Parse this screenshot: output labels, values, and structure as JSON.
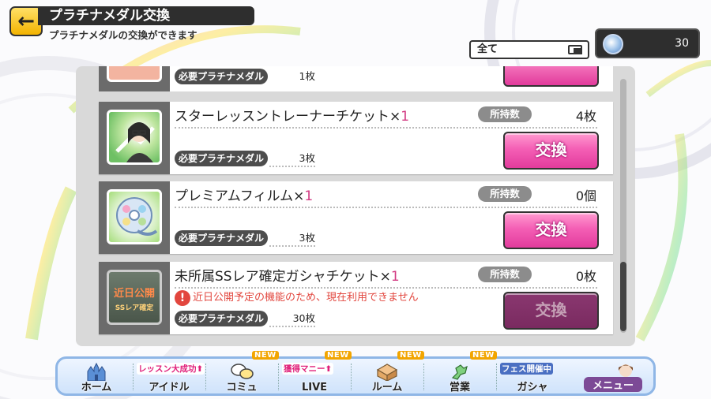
{
  "header": {
    "title": "プラチナメダル交換",
    "subtitle": "プラチナメダルの交換ができます",
    "back_icon": "back-arrow-icon"
  },
  "filter": {
    "selected": "全て",
    "icon": "list-select-icon"
  },
  "medal_counter": {
    "icon": "platinum-medal-icon",
    "value": "30"
  },
  "list": {
    "partial_item": {
      "req_label": "必要プラチナメダル",
      "req_value": "1枚"
    },
    "items": [
      {
        "name": "スターレッスントレーナーチケット×",
        "qty": "1",
        "owned_label": "所持数",
        "owned_value": "4枚",
        "req_label": "必要プラチナメダル",
        "req_value": "3枚",
        "button": "交換",
        "icon": "trainer-ticket-icon",
        "enabled": true
      },
      {
        "name": "プレミアムフィルム×",
        "qty": "1",
        "owned_label": "所持数",
        "owned_value": "0個",
        "req_label": "必要プラチナメダル",
        "req_value": "3枚",
        "button": "交換",
        "icon": "premium-film-icon",
        "enabled": true
      },
      {
        "name": "未所属SSレア確定ガシャチケット×",
        "qty": "1",
        "owned_label": "所持数",
        "owned_value": "0枚",
        "req_label": "必要プラチナメダル",
        "req_value": "30枚",
        "button": "交換",
        "icon": "gacha-ticket-icon",
        "thumb_text_1": "近日公開",
        "thumb_text_2": "SSレア確定",
        "notice": "近日公開予定の機能のため、現在利用できません",
        "enabled": false
      }
    ]
  },
  "nav": {
    "items": [
      {
        "label": "ホーム",
        "icon": "castle-icon"
      },
      {
        "label": "アイドル",
        "tag": "レッスン大成功⬆",
        "icon": "idol-icon"
      },
      {
        "label": "コミュ",
        "new": "NEW",
        "icon": "chat-bubbles-icon"
      },
      {
        "label": "LIVE",
        "tag": "獲得マニー⬆",
        "new": "NEW",
        "icon": "live-icon"
      },
      {
        "label": "ルーム",
        "new": "NEW",
        "icon": "room-icon"
      },
      {
        "label": "営業",
        "new": "NEW",
        "icon": "map-icon"
      },
      {
        "label": "ガシャ",
        "tag": "フェス開催中",
        "icon": "gacha-icon"
      },
      {
        "label": "メニュー",
        "icon": "menu-avatar-icon"
      }
    ]
  }
}
